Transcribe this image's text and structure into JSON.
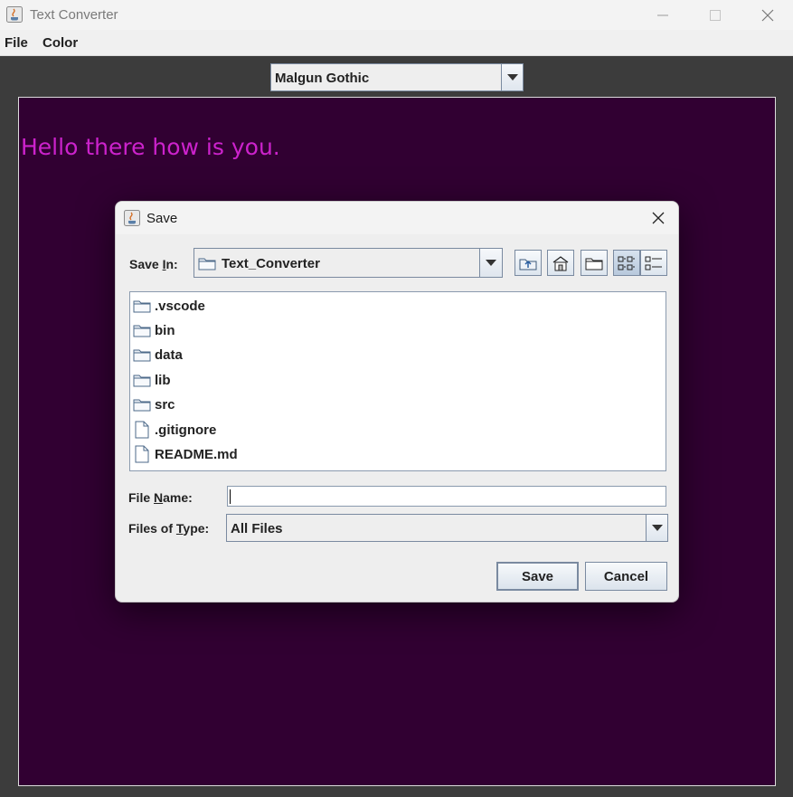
{
  "window": {
    "title": "Text Converter"
  },
  "menu": {
    "file": "File",
    "color": "Color"
  },
  "font_selector": {
    "value": "Malgun Gothic"
  },
  "editor": {
    "text": "Hello there how is you.",
    "background": "#310032",
    "text_color": "#cc22cc"
  },
  "dialog": {
    "title": "Save",
    "save_in_label_pre": "Save ",
    "save_in_label_u": "I",
    "save_in_label_post": "n:",
    "save_in_value": "Text_Converter",
    "files": [
      {
        "name": ".vscode",
        "kind": "folder-icon"
      },
      {
        "name": "bin",
        "kind": "folder-icon"
      },
      {
        "name": "data",
        "kind": "folder-icon"
      },
      {
        "name": "lib",
        "kind": "folder-icon"
      },
      {
        "name": "src",
        "kind": "folder-icon"
      },
      {
        "name": ".gitignore",
        "kind": "file-icon"
      },
      {
        "name": "README.md",
        "kind": "file-icon"
      }
    ],
    "file_name_label_pre": "File ",
    "file_name_label_u": "N",
    "file_name_label_post": "ame:",
    "file_name_value": "",
    "files_of_type_label_pre": "Files of ",
    "files_of_type_label_u": "T",
    "files_of_type_label_post": "ype:",
    "files_of_type_value": "All Files",
    "save_button": "Save",
    "cancel_button": "Cancel"
  }
}
